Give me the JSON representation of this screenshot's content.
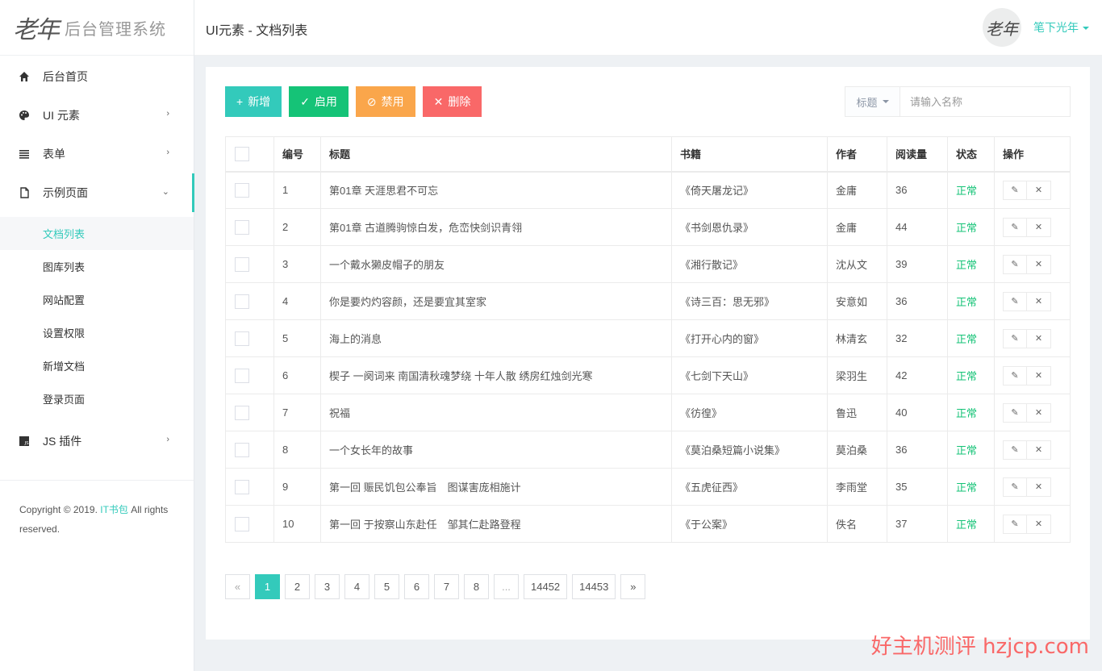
{
  "brand": {
    "logo_mark": "老年",
    "name": "后台管理系统"
  },
  "header": {
    "title": "UI元素 - 文档列表",
    "avatar_text": "老年",
    "user_name": "笔下光年"
  },
  "sidebar": {
    "items": [
      {
        "label": "后台首页",
        "icon": "home-icon"
      },
      {
        "label": "UI 元素",
        "icon": "palette-icon"
      },
      {
        "label": "表单",
        "icon": "list-icon"
      },
      {
        "label": "示例页面",
        "icon": "file-icon"
      }
    ],
    "subitems": [
      "文档列表",
      "图库列表",
      "网站配置",
      "设置权限",
      "新增文档",
      "登录页面"
    ],
    "active_sub": "文档列表",
    "js_item": {
      "label": "JS 插件",
      "icon": "js-icon"
    },
    "copyright_prefix": "Copyright © 2019.",
    "copyright_link": "IT书包",
    "copyright_suffix": "All rights reserved."
  },
  "toolbar": {
    "add": "新增",
    "enable": "启用",
    "disable": "禁用",
    "delete": "删除"
  },
  "search": {
    "field": "标题",
    "placeholder": "请输入名称"
  },
  "table": {
    "headers": [
      "编号",
      "标题",
      "书籍",
      "作者",
      "阅读量",
      "状态",
      "操作"
    ],
    "rows": [
      {
        "id": "1",
        "title": "第01章 天涯思君不可忘",
        "book": "《倚天屠龙记》",
        "author": "金庸",
        "reads": "36",
        "status": "正常"
      },
      {
        "id": "2",
        "title": "第01章 古道腾驹惊白发，危峦快剑识青翎",
        "book": "《书剑恩仇录》",
        "author": "金庸",
        "reads": "44",
        "status": "正常"
      },
      {
        "id": "3",
        "title": "一个戴水獭皮帽子的朋友",
        "book": "《湘行散记》",
        "author": "沈从文",
        "reads": "39",
        "status": "正常"
      },
      {
        "id": "4",
        "title": "你是要灼灼容颜，还是要宜其室家",
        "book": "《诗三百：思无邪》",
        "author": "安意如",
        "reads": "36",
        "status": "正常"
      },
      {
        "id": "5",
        "title": "海上的消息",
        "book": "《打开心内的窗》",
        "author": "林清玄",
        "reads": "32",
        "status": "正常"
      },
      {
        "id": "6",
        "title": "楔子 一阕词来 南国清秋魂梦绕 十年人散 绣房红烛剑光寒",
        "book": "《七剑下天山》",
        "author": "梁羽生",
        "reads": "42",
        "status": "正常"
      },
      {
        "id": "7",
        "title": "祝福",
        "book": "《彷徨》",
        "author": "鲁迅",
        "reads": "40",
        "status": "正常"
      },
      {
        "id": "8",
        "title": "一个女长年的故事",
        "book": "《莫泊桑短篇小说集》",
        "author": "莫泊桑",
        "reads": "36",
        "status": "正常"
      },
      {
        "id": "9",
        "title": "第一回 赈民饥包公奉旨　图谋害庞相施计",
        "book": "《五虎征西》",
        "author": "李雨堂",
        "reads": "35",
        "status": "正常"
      },
      {
        "id": "10",
        "title": "第一回 于按察山东赴任　邹其仁赴路登程",
        "book": "《于公案》",
        "author": "佚名",
        "reads": "37",
        "status": "正常"
      }
    ]
  },
  "pagination": {
    "prev": "«",
    "pages": [
      "1",
      "2",
      "3",
      "4",
      "5",
      "6",
      "7",
      "8",
      "...",
      "14452",
      "14453"
    ],
    "current": "1",
    "next": "»"
  },
  "watermark": "好主机测评 hzjcp.com",
  "colors": {
    "accent": "#33cabb",
    "success": "#15c377",
    "warning": "#faa64b",
    "danger": "#f96868"
  }
}
